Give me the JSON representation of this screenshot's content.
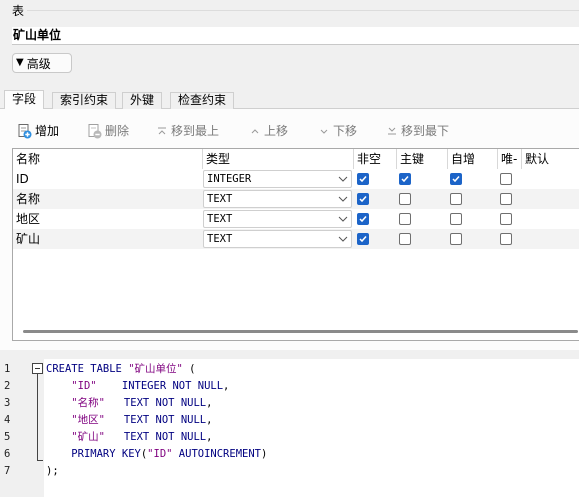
{
  "group": {
    "label": "表"
  },
  "table_name": "矿山单位",
  "advanced_button": {
    "label": "高级",
    "icon": "triangle-down-icon"
  },
  "tabs": [
    {
      "label": "字段",
      "active": true
    },
    {
      "label": "索引约束",
      "active": false
    },
    {
      "label": "外键",
      "active": false
    },
    {
      "label": "检查约束",
      "active": false
    }
  ],
  "toolbar": {
    "add": "增加",
    "delete": "删除",
    "move_top": "移到最上",
    "move_up": "上移",
    "move_down": "下移",
    "move_bottom": "移到最下"
  },
  "grid": {
    "headers": [
      "名称",
      "类型",
      "非空",
      "主键",
      "自增",
      "唯-",
      "默认"
    ],
    "rows": [
      {
        "name": "ID",
        "type": "INTEGER",
        "not_null": true,
        "pk": true,
        "autoinc": true,
        "unique": false,
        "default": ""
      },
      {
        "name": "名称",
        "type": "TEXT",
        "not_null": true,
        "pk": false,
        "autoinc": false,
        "unique": false,
        "default": ""
      },
      {
        "name": "地区",
        "type": "TEXT",
        "not_null": true,
        "pk": false,
        "autoinc": false,
        "unique": false,
        "default": ""
      },
      {
        "name": "矿山",
        "type": "TEXT",
        "not_null": true,
        "pk": false,
        "autoinc": false,
        "unique": false,
        "default": ""
      }
    ]
  },
  "sql": {
    "line_numbers": [
      "1",
      "2",
      "3",
      "4",
      "5",
      "6",
      "7"
    ],
    "lines": [
      [
        {
          "t": "kw",
          "v": "CREATE TABLE "
        },
        {
          "t": "str",
          "v": "\"矿山单位\""
        },
        {
          "t": "plain",
          "v": " ("
        }
      ],
      [
        {
          "t": "plain",
          "v": "    "
        },
        {
          "t": "str",
          "v": "\"ID\""
        },
        {
          "t": "plain",
          "v": "    "
        },
        {
          "t": "kw",
          "v": "INTEGER NOT NULL"
        },
        {
          "t": "plain",
          "v": ","
        }
      ],
      [
        {
          "t": "plain",
          "v": "    "
        },
        {
          "t": "str",
          "v": "\"名称\""
        },
        {
          "t": "plain",
          "v": "   "
        },
        {
          "t": "kw",
          "v": "TEXT NOT NULL"
        },
        {
          "t": "plain",
          "v": ","
        }
      ],
      [
        {
          "t": "plain",
          "v": "    "
        },
        {
          "t": "str",
          "v": "\"地区\""
        },
        {
          "t": "plain",
          "v": "   "
        },
        {
          "t": "kw",
          "v": "TEXT NOT NULL"
        },
        {
          "t": "plain",
          "v": ","
        }
      ],
      [
        {
          "t": "plain",
          "v": "    "
        },
        {
          "t": "str",
          "v": "\"矿山\""
        },
        {
          "t": "plain",
          "v": "   "
        },
        {
          "t": "kw",
          "v": "TEXT NOT NULL"
        },
        {
          "t": "plain",
          "v": ","
        }
      ],
      [
        {
          "t": "plain",
          "v": "    "
        },
        {
          "t": "kw",
          "v": "PRIMARY KEY"
        },
        {
          "t": "plain",
          "v": "("
        },
        {
          "t": "str",
          "v": "\"ID\""
        },
        {
          "t": "plain",
          "v": " "
        },
        {
          "t": "kw",
          "v": "AUTOINCREMENT"
        },
        {
          "t": "plain",
          "v": ")"
        }
      ],
      [
        {
          "t": "plain",
          "v": ");"
        }
      ]
    ]
  },
  "colors": {
    "accent": "#1c64c8",
    "keyword": "#000080",
    "string": "#7f007f"
  }
}
